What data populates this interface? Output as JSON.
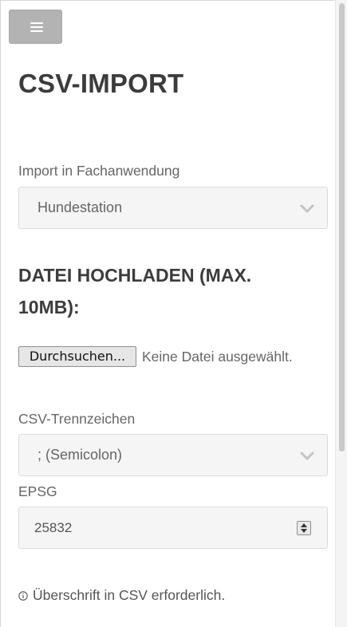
{
  "menu": {
    "icon": "hamburger-icon"
  },
  "page": {
    "title": "CSV-IMPORT"
  },
  "form": {
    "fachanwendung": {
      "label": "Import in Fachanwendung",
      "value": "Hundestation"
    },
    "upload": {
      "heading": "DATEI HOCHLADEN (MAX. 10MB):",
      "button_label": "Durchsuchen...",
      "status": "Keine Datei ausgewählt."
    },
    "delimiter": {
      "label": "CSV-Trennzeichen",
      "value": "; (Semicolon)"
    },
    "epsg": {
      "label": "EPSG",
      "value": "25832"
    },
    "notice": {
      "icon": "info-icon",
      "text": "Überschrift in CSV erforderlich."
    }
  },
  "colors": {
    "menu_button": "#b3b3b3",
    "heading": "#3c3c3c",
    "field_background": "#f5f5f5"
  }
}
